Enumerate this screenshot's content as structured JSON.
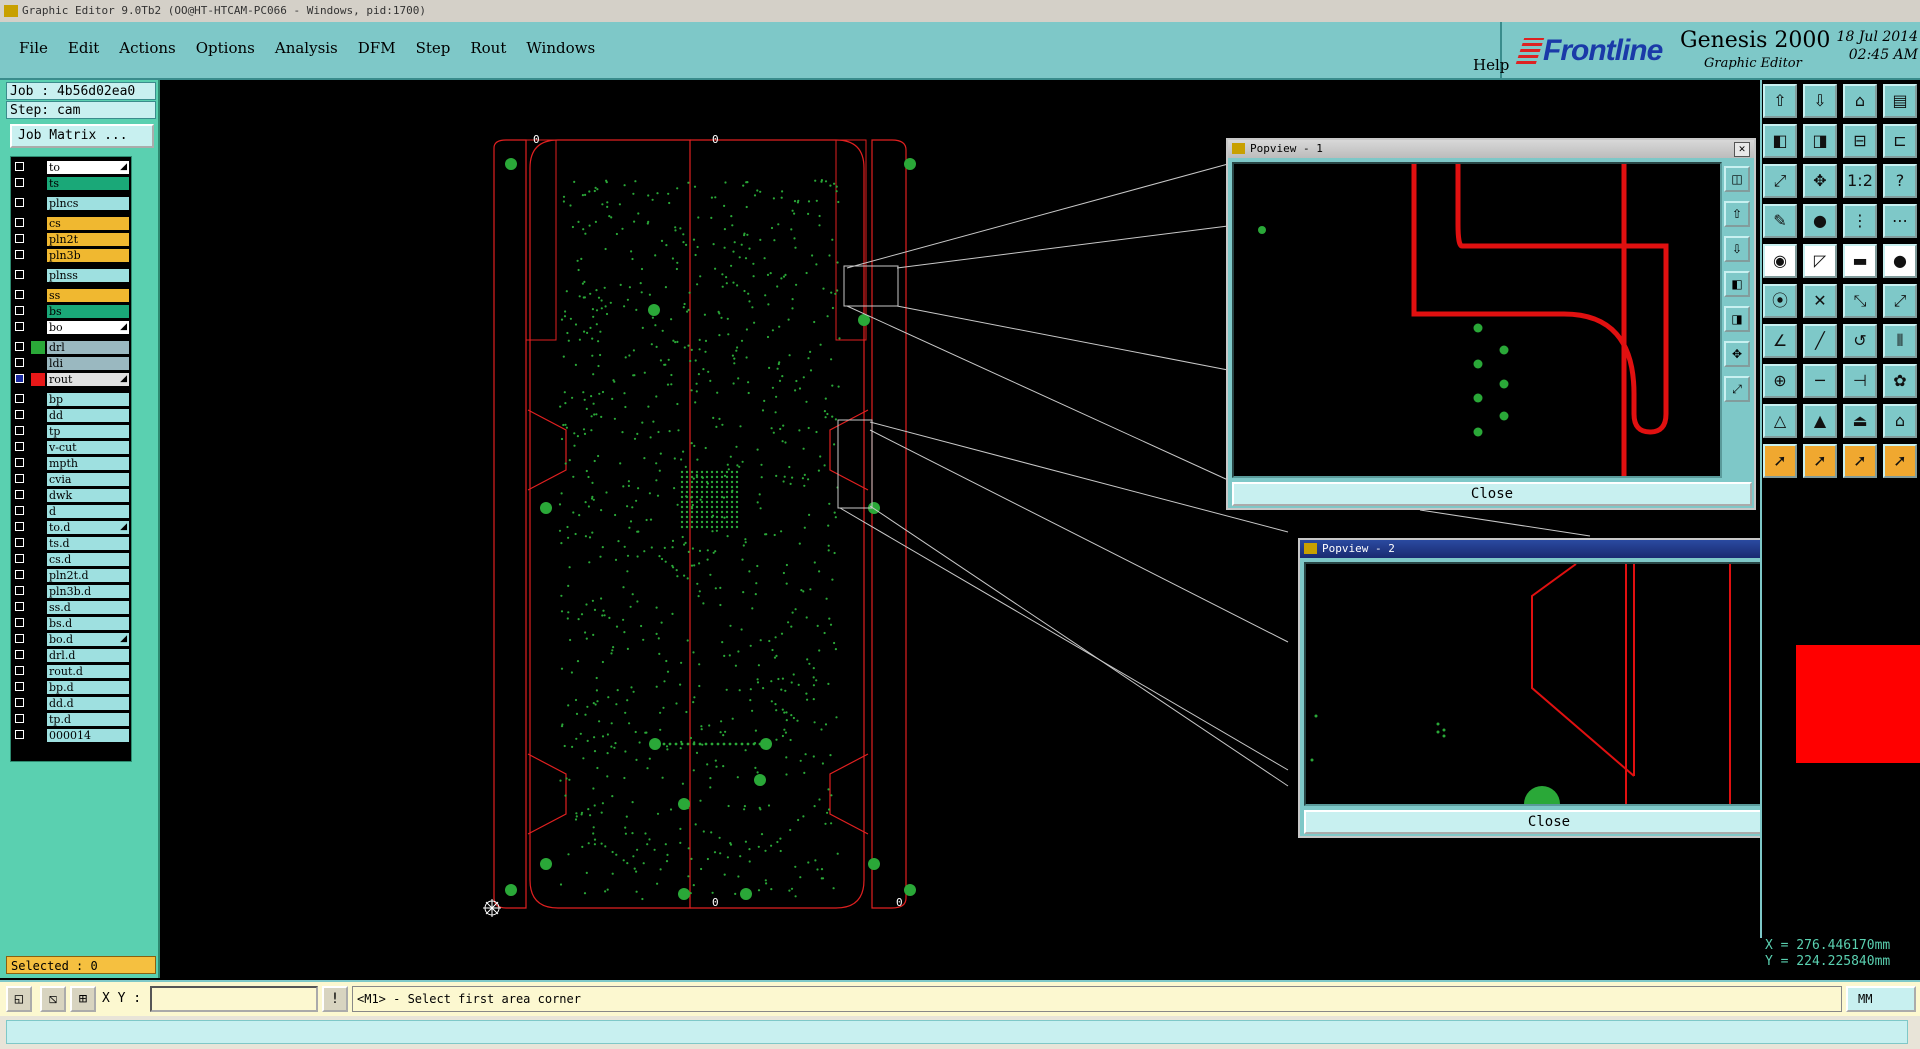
{
  "window": {
    "title": "Graphic Editor 9.0Tb2 (OO@HT-HTCAM-PC066 - Windows, pid:1700)"
  },
  "menu": {
    "items": [
      "File",
      "Edit",
      "Actions",
      "Options",
      "Analysis",
      "DFM",
      "Step",
      "Rout",
      "Windows"
    ],
    "help": "Help"
  },
  "brand": {
    "logo": "Frontline",
    "product": "Genesis 2000",
    "subtitle": "Graphic Editor",
    "date": "18 Jul 2014",
    "time": "02:45 AM"
  },
  "job": {
    "job_label": "Job : 4b56d02ea0",
    "step_label": "Step: cam",
    "matrix_button": "Job Matrix ..."
  },
  "layers": [
    {
      "name": "to",
      "color": "#ffffff",
      "swatch": "#000000",
      "mark": true
    },
    {
      "name": "ts",
      "color": "#1aa878",
      "swatch": "#000000"
    },
    {
      "name": "plncs",
      "color": "#9ee0e0",
      "swatch": "#000000",
      "gap": true
    },
    {
      "name": "cs",
      "color": "#f0b830",
      "swatch": "#000000",
      "gap": true
    },
    {
      "name": "pln2t",
      "color": "#f0b830",
      "swatch": "#000000"
    },
    {
      "name": "pln3b",
      "color": "#f0b830",
      "swatch": "#000000"
    },
    {
      "name": "plnss",
      "color": "#9ee0e0",
      "swatch": "#000000",
      "gap": true
    },
    {
      "name": "ss",
      "color": "#f0b830",
      "swatch": "#000000",
      "gap": true
    },
    {
      "name": "bs",
      "color": "#1aa878",
      "swatch": "#000000"
    },
    {
      "name": "bo",
      "color": "#ffffff",
      "swatch": "#000000",
      "mark": true
    },
    {
      "name": "drl",
      "color": "#9ab8c0",
      "swatch": "#2aa838",
      "gap": true
    },
    {
      "name": "ldi",
      "color": "#9ab8c0",
      "swatch": "#000000"
    },
    {
      "name": "rout",
      "color": "#e0e0e0",
      "swatch": "#e81818",
      "checked": true,
      "mark": true
    },
    {
      "name": "bp",
      "color": "#9ee0e0",
      "swatch": "#000000",
      "gap": true
    },
    {
      "name": "dd",
      "color": "#9ee0e0",
      "swatch": "#000000"
    },
    {
      "name": "tp",
      "color": "#9ee0e0",
      "swatch": "#000000"
    },
    {
      "name": "v-cut",
      "color": "#9ee0e0",
      "swatch": "#000000"
    },
    {
      "name": "mpth",
      "color": "#9ee0e0",
      "swatch": "#000000"
    },
    {
      "name": "cvia",
      "color": "#9ee0e0",
      "swatch": "#000000"
    },
    {
      "name": "dwk",
      "color": "#9ee0e0",
      "swatch": "#000000"
    },
    {
      "name": "d",
      "color": "#9ee0e0",
      "swatch": "#000000"
    },
    {
      "name": "to.d",
      "color": "#9ee0e0",
      "swatch": "#000000",
      "mark": true
    },
    {
      "name": "ts.d",
      "color": "#9ee0e0",
      "swatch": "#000000"
    },
    {
      "name": "cs.d",
      "color": "#9ee0e0",
      "swatch": "#000000"
    },
    {
      "name": "pln2t.d",
      "color": "#9ee0e0",
      "swatch": "#000000"
    },
    {
      "name": "pln3b.d",
      "color": "#9ee0e0",
      "swatch": "#000000"
    },
    {
      "name": "ss.d",
      "color": "#9ee0e0",
      "swatch": "#000000"
    },
    {
      "name": "bs.d",
      "color": "#9ee0e0",
      "swatch": "#000000"
    },
    {
      "name": "bo.d",
      "color": "#9ee0e0",
      "swatch": "#000000",
      "mark": true
    },
    {
      "name": "drl.d",
      "color": "#9ee0e0",
      "swatch": "#000000"
    },
    {
      "name": "rout.d",
      "color": "#9ee0e0",
      "swatch": "#000000"
    },
    {
      "name": "bp.d",
      "color": "#9ee0e0",
      "swatch": "#000000"
    },
    {
      "name": "dd.d",
      "color": "#9ee0e0",
      "swatch": "#000000"
    },
    {
      "name": "tp.d",
      "color": "#9ee0e0",
      "swatch": "#000000"
    },
    {
      "name": "000014",
      "color": "#9ee0e0",
      "swatch": "#000000"
    }
  ],
  "selected": "Selected : 0",
  "canvas": {
    "datum_labels": [
      "0",
      "0",
      "0",
      "0"
    ],
    "outline_color": "#e02020",
    "pad_color": "#2aa838"
  },
  "popview1": {
    "title": "Popview - 1",
    "close": "Close"
  },
  "popview2": {
    "title": "Popview - 2",
    "close": "Close"
  },
  "coords": {
    "x": "X = 276.446170mm",
    "y": "Y = 224.225840mm"
  },
  "statusbar": {
    "xy_label": "X Y :",
    "xy_value": "",
    "message": "<M1> - Select first area corner",
    "units": "MM"
  },
  "toolbar_icons": [
    [
      "home-up-icon",
      "save-down-icon",
      "home-icon",
      "panel-icon"
    ],
    [
      "move-left-icon",
      "move-right-icon",
      "split-icon",
      "pan-icon"
    ],
    [
      "zoom-fit-icon",
      "zoom-center-icon",
      "ratio-icon",
      "help-icon"
    ],
    [
      "measure-icon",
      "snap-icon",
      "route-icon",
      "route2-icon"
    ],
    [
      "pad-icon",
      "line-icon",
      "dashed-icon",
      "circle-icon"
    ],
    [
      "node-icon",
      "cross-icon",
      "link-icon",
      "link2-icon"
    ],
    [
      "angle-icon",
      "diagonal-icon",
      "arc-icon",
      "parallel-icon"
    ],
    [
      "add-pad-icon",
      "dash-line-icon",
      "bracket-icon",
      "blob-icon"
    ],
    [
      "triangle-icon",
      "triangle2-icon",
      "shape-icon",
      "shape2-icon"
    ],
    [
      "select-icon",
      "select2-icon",
      "select3-icon",
      "select4-icon"
    ]
  ]
}
